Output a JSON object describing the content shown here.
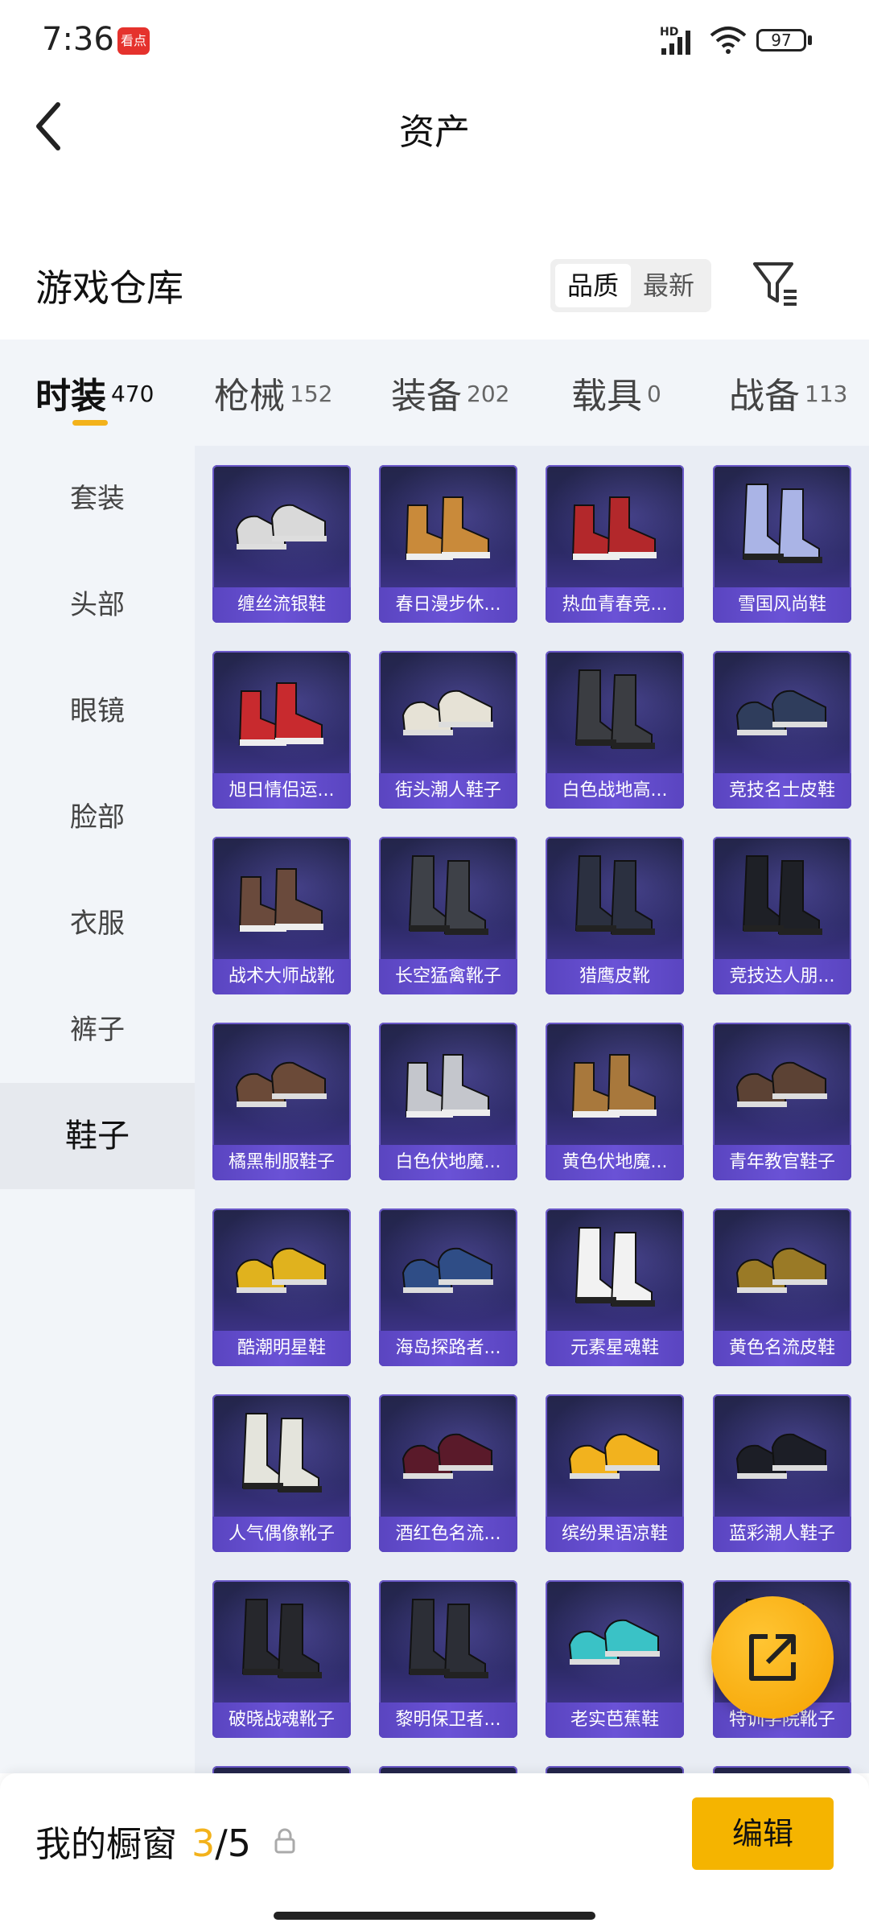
{
  "status_bar": {
    "time": "7:36",
    "app_badge": "看点",
    "network": "HD",
    "battery": "97"
  },
  "header": {
    "title": "资产"
  },
  "warehouse": {
    "title": "游戏仓库",
    "sort_options": [
      "品质",
      "最新"
    ],
    "active_sort": "品质"
  },
  "tabs": [
    {
      "label": "时装",
      "count": "470",
      "active": true
    },
    {
      "label": "枪械",
      "count": "152",
      "active": false
    },
    {
      "label": "装备",
      "count": "202",
      "active": false
    },
    {
      "label": "载具",
      "count": "0",
      "active": false
    },
    {
      "label": "战备",
      "count": "113",
      "active": false
    }
  ],
  "sidebar": {
    "items": [
      "套装",
      "头部",
      "眼镜",
      "脸部",
      "衣服",
      "裤子",
      "鞋子"
    ],
    "active": "鞋子"
  },
  "items": [
    {
      "name": "缠丝流银鞋",
      "color": "#d9d9d9",
      "shape": "low"
    },
    {
      "name": "春日漫步休...",
      "color": "#c98a3a",
      "shape": "high"
    },
    {
      "name": "热血青春竞...",
      "color": "#b3282b",
      "shape": "high"
    },
    {
      "name": "雪国风尚鞋",
      "color": "#aab4e6",
      "shape": "boot"
    },
    {
      "name": "旭日情侣运...",
      "color": "#c82a2e",
      "shape": "high"
    },
    {
      "name": "街头潮人鞋子",
      "color": "#e6e2d6",
      "shape": "low"
    },
    {
      "name": "白色战地高...",
      "color": "#3b3d42",
      "shape": "boot"
    },
    {
      "name": "竞技名士皮鞋",
      "color": "#2f3d5c",
      "shape": "low"
    },
    {
      "name": "战术大师战靴",
      "color": "#6a4a3c",
      "shape": "high"
    },
    {
      "name": "长空猛禽靴子",
      "color": "#3e4148",
      "shape": "boot"
    },
    {
      "name": "猎鹰皮靴",
      "color": "#2b3040",
      "shape": "boot"
    },
    {
      "name": "竞技达人朋...",
      "color": "#1e2026",
      "shape": "boot"
    },
    {
      "name": "橘黑制服鞋子",
      "color": "#6b4a38",
      "shape": "low"
    },
    {
      "name": "白色伏地魔...",
      "color": "#c4c6cc",
      "shape": "high"
    },
    {
      "name": "黄色伏地魔...",
      "color": "#a8783c",
      "shape": "high"
    },
    {
      "name": "青年教官鞋子",
      "color": "#5c4234",
      "shape": "low"
    },
    {
      "name": "酷潮明星鞋",
      "color": "#e0b21e",
      "shape": "low"
    },
    {
      "name": "海岛探路者...",
      "color": "#2f4d86",
      "shape": "low"
    },
    {
      "name": "元素星魂鞋",
      "color": "#f2f2f2",
      "shape": "boot"
    },
    {
      "name": "黄色名流皮鞋",
      "color": "#9a7a26",
      "shape": "low"
    },
    {
      "name": "人气偶像靴子",
      "color": "#e4e4dc",
      "shape": "boot"
    },
    {
      "name": "酒红色名流...",
      "color": "#5a1a2a",
      "shape": "low"
    },
    {
      "name": "缤纷果语凉鞋",
      "color": "#f2b21e",
      "shape": "low"
    },
    {
      "name": "蓝彩潮人鞋子",
      "color": "#1c1e26",
      "shape": "low"
    },
    {
      "name": "破晓战魂靴子",
      "color": "#26272c",
      "shape": "boot"
    },
    {
      "name": "黎明保卫者...",
      "color": "#2c2e36",
      "shape": "boot"
    },
    {
      "name": "老实芭蕉鞋",
      "color": "#3ac2c6",
      "shape": "low"
    },
    {
      "name": "特训学院靴子",
      "color": "#3a3c44",
      "shape": "boot"
    }
  ],
  "bottom": {
    "showcase_label": "我的橱窗",
    "showcase_current": "3",
    "showcase_sep": "/",
    "showcase_total": "5",
    "edit_label": "编辑"
  }
}
